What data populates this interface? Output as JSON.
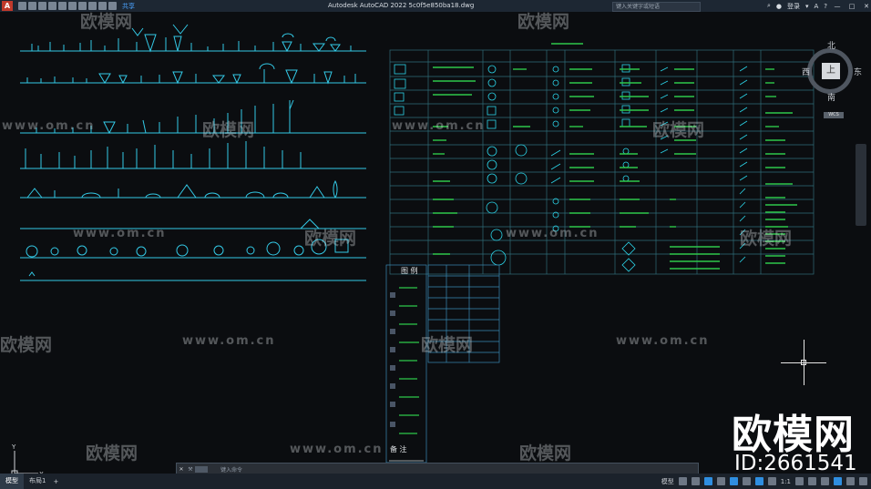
{
  "app": {
    "title": "Autodesk AutoCAD 2022    5c0f5e850ba18.dwg",
    "logo": "A",
    "share_label": "共享",
    "search_placeholder": "键入关键字或短语",
    "login_label": "登录",
    "help_label": "?"
  },
  "window_controls": [
    "—",
    "□",
    "✕"
  ],
  "viewcube": {
    "north": "北",
    "south": "南",
    "west": "西",
    "east": "东",
    "face": "上",
    "wcs": "WCS"
  },
  "watermarks": {
    "url": "www.om.cn",
    "brand": "欧模网",
    "big_brand": "欧模网",
    "id": "ID:2661541"
  },
  "command_line": {
    "close": "✕",
    "prompt": "键入命令"
  },
  "layout_tabs": [
    {
      "label": "模型",
      "active": true
    },
    {
      "label": "布局1",
      "active": false
    }
  ],
  "add_tab": "+",
  "status": {
    "model_label": "模型",
    "scale_label": "1:1"
  },
  "legend_panel": {
    "title": "图 例",
    "notes_title": "备 注"
  },
  "icons": [
    "autocad-logo",
    "new-icon",
    "open-icon",
    "save-icon",
    "undo-icon",
    "redo-icon",
    "search-icon",
    "user-icon",
    "help-icon",
    "grid-icon",
    "snap-icon",
    "gear-icon"
  ]
}
